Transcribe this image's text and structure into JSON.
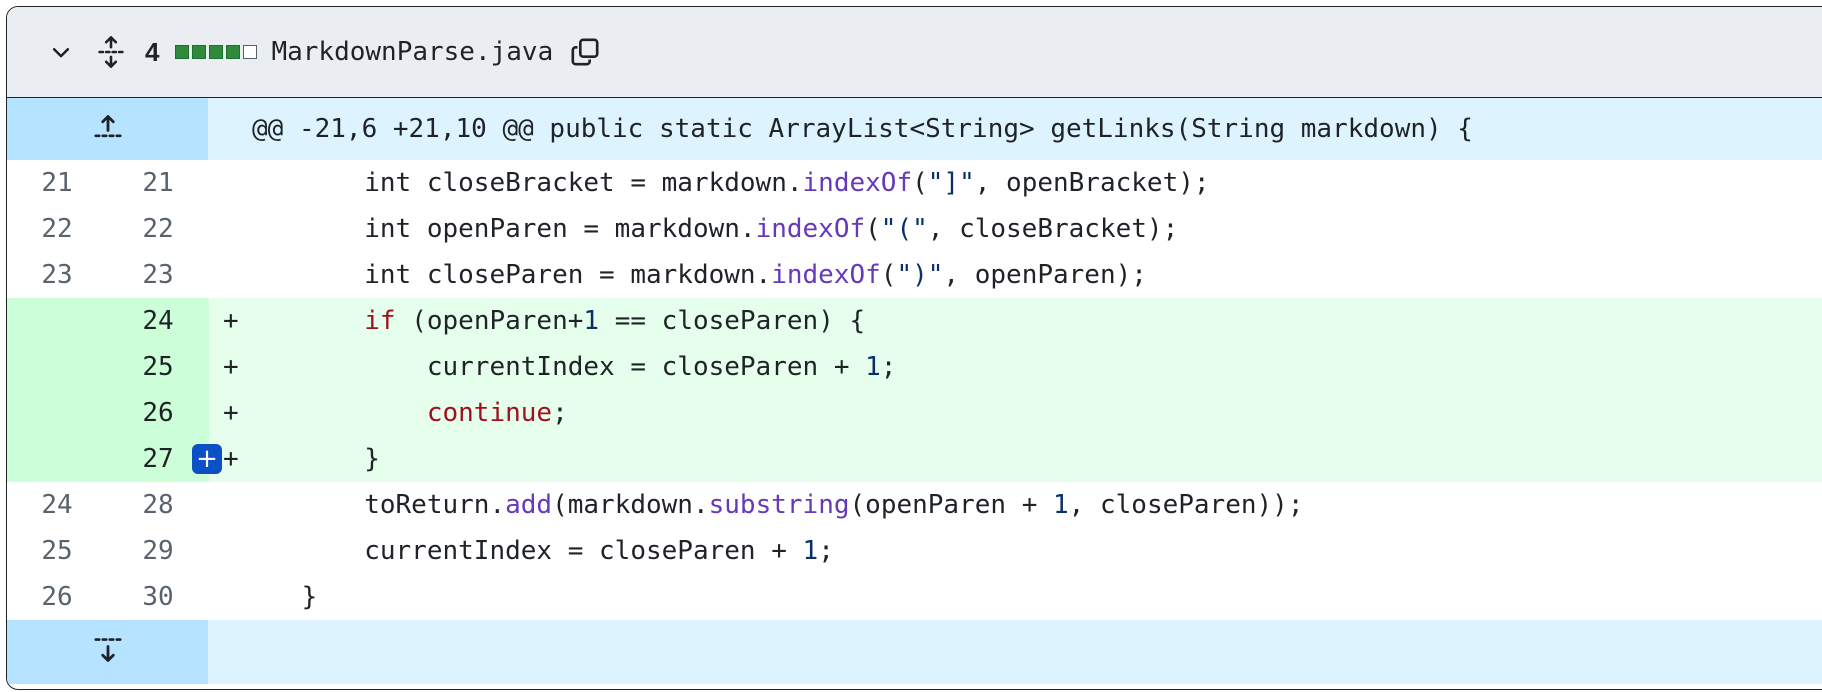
{
  "file": {
    "changes_count": "4",
    "diffstat": [
      "add",
      "add",
      "add",
      "add",
      "neutral"
    ],
    "filename": "MarkdownParse.java"
  },
  "hunk_header": "@@ -21,6 +21,10 @@ public static ArrayList<String> getLinks(String markdown) {",
  "lines": [
    {
      "type": "context",
      "old": "21",
      "new": "21",
      "sign": "",
      "code": [
        [
          "t",
          "        int closeBracket = markdown."
        ],
        [
          "fn",
          "indexOf"
        ],
        [
          "t",
          "("
        ],
        [
          "str",
          "\"]\""
        ],
        [
          "t",
          ", openBracket);"
        ]
      ]
    },
    {
      "type": "context",
      "old": "22",
      "new": "22",
      "sign": "",
      "code": [
        [
          "t",
          "        int openParen = markdown."
        ],
        [
          "fn",
          "indexOf"
        ],
        [
          "t",
          "("
        ],
        [
          "str",
          "\"(\""
        ],
        [
          "t",
          ", closeBracket);"
        ]
      ]
    },
    {
      "type": "context",
      "old": "23",
      "new": "23",
      "sign": "",
      "code": [
        [
          "t",
          "        int closeParen = markdown."
        ],
        [
          "fn",
          "indexOf"
        ],
        [
          "t",
          "("
        ],
        [
          "str",
          "\")\""
        ],
        [
          "t",
          ", openParen);"
        ]
      ]
    },
    {
      "type": "add",
      "old": "",
      "new": "24",
      "sign": "+",
      "code": [
        [
          "t",
          "        "
        ],
        [
          "kw",
          "if"
        ],
        [
          "t",
          " (openParen+"
        ],
        [
          "num",
          "1"
        ],
        [
          "t",
          " == closeParen) {"
        ]
      ]
    },
    {
      "type": "add",
      "old": "",
      "new": "25",
      "sign": "+",
      "code": [
        [
          "t",
          "            currentIndex = closeParen + "
        ],
        [
          "num",
          "1"
        ],
        [
          "t",
          ";"
        ]
      ]
    },
    {
      "type": "add",
      "old": "",
      "new": "26",
      "sign": "+",
      "code": [
        [
          "t",
          "            "
        ],
        [
          "kw",
          "continue"
        ],
        [
          "t",
          ";"
        ]
      ]
    },
    {
      "type": "add",
      "old": "",
      "new": "27",
      "sign": "+",
      "code": [
        [
          "t",
          "        }"
        ]
      ],
      "comment_button": "+"
    },
    {
      "type": "context",
      "old": "24",
      "new": "28",
      "sign": "",
      "code": [
        [
          "t",
          "        toReturn."
        ],
        [
          "fn",
          "add"
        ],
        [
          "t",
          "(markdown."
        ],
        [
          "fn",
          "substring"
        ],
        [
          "t",
          "(openParen + "
        ],
        [
          "num",
          "1"
        ],
        [
          "t",
          ", closeParen));"
        ]
      ]
    },
    {
      "type": "context",
      "old": "25",
      "new": "29",
      "sign": "",
      "code": [
        [
          "t",
          "        currentIndex = closeParen + "
        ],
        [
          "num",
          "1"
        ],
        [
          "t",
          ";"
        ]
      ]
    },
    {
      "type": "context",
      "old": "26",
      "new": "30",
      "sign": "",
      "code": [
        [
          "t",
          "    }"
        ]
      ]
    }
  ],
  "icons": {
    "collapse": "chevron-down-icon",
    "expand_all": "unfold-icon",
    "copy": "copy-icon",
    "expand_up": "fold-up-icon",
    "expand_down": "fold-down-icon"
  },
  "colors": {
    "added_bg": "#e6ffec",
    "added_gutter": "#ccffd8",
    "hunk_bg": "#ddf4ff",
    "hunk_gutter": "#b6e3ff",
    "function": "#6639ba",
    "keyword": "#a0111f",
    "number": "#0a3069"
  }
}
